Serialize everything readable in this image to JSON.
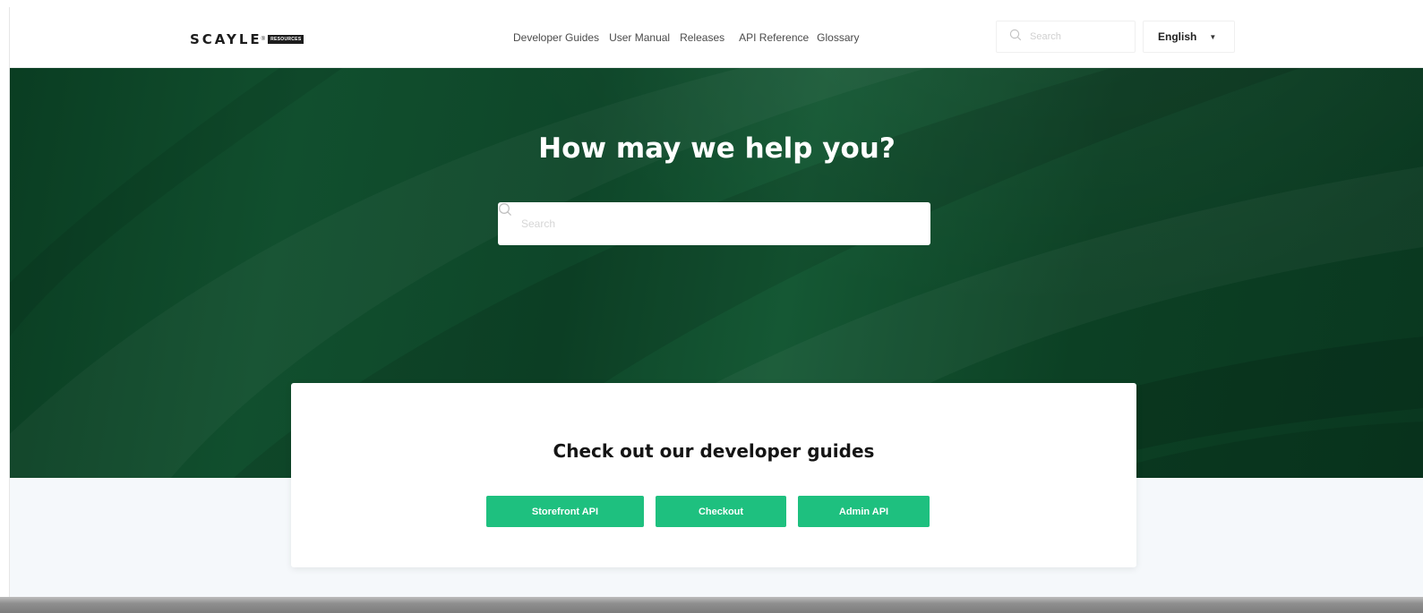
{
  "header": {
    "logo": {
      "wordmark": "SCAYLE",
      "registered": "®",
      "badge": "RESOURCES"
    },
    "nav": [
      {
        "label": "Developer Guides"
      },
      {
        "label": "User Manual"
      },
      {
        "label": "Releases"
      },
      {
        "label": "API Reference"
      },
      {
        "label": "Glossary"
      }
    ],
    "search": {
      "placeholder": "Search",
      "icon": "search-icon"
    },
    "language": {
      "selected": "English",
      "icon": "chevron-down-icon"
    }
  },
  "hero": {
    "title": "How may we help you?",
    "search": {
      "placeholder": "Search",
      "icon": "search-icon"
    },
    "colors": {
      "primary": "#0f4a2b",
      "dark": "#0a3820"
    }
  },
  "guides_card": {
    "title": "Check out our developer guides",
    "buttons": [
      {
        "label": "Storefront API"
      },
      {
        "label": "Checkout"
      },
      {
        "label": "Admin API"
      }
    ],
    "button_color": "#1ec07f"
  }
}
